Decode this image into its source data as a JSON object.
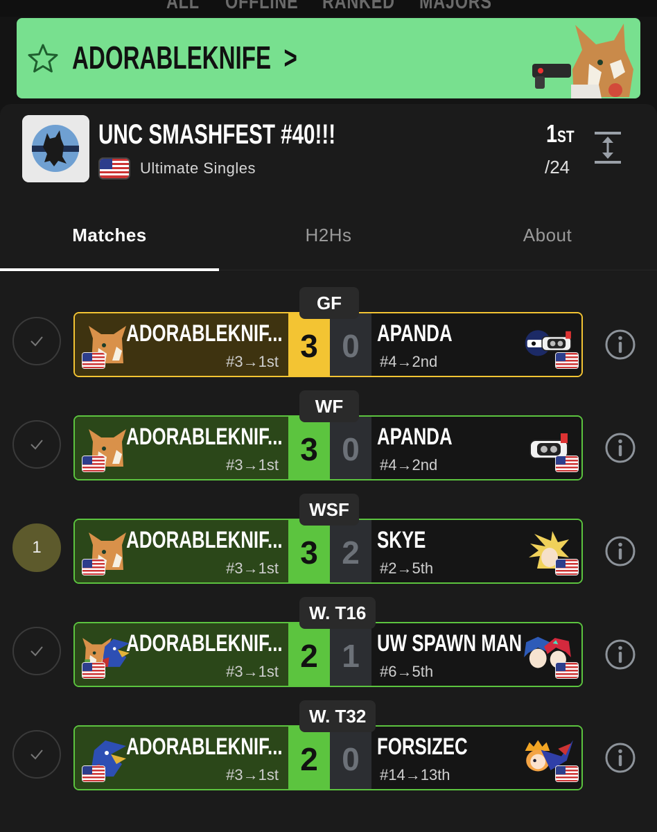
{
  "top_nav": {
    "items": [
      "ALL",
      "OFFLINE",
      "RANKED",
      "MAJORS"
    ]
  },
  "banner": {
    "player_name": "ADORABLEKNIFE",
    "chevron": ">",
    "character_icon": "fox-icon"
  },
  "tournament": {
    "title": "UNC SMASHFEST #40!!!",
    "event": "Ultimate Singles",
    "placement": "1",
    "placement_suffix": "ST",
    "entrants": "/24",
    "flag_icon": "us-flag-icon"
  },
  "tabs": [
    {
      "label": "Matches",
      "active": true
    },
    {
      "label": "H2Hs",
      "active": false
    },
    {
      "label": "About",
      "active": false
    }
  ],
  "colors": {
    "banner_green": "#78e08f",
    "win_gold": "#f3c433",
    "win_green": "#5cc43f"
  },
  "matches": [
    {
      "round": "GF",
      "status": "check",
      "status_label": "✓",
      "style": "gold",
      "p1": {
        "name": "ADORABLEKNIF...",
        "seed": "#3→1st",
        "characters": [
          "fox-icon"
        ]
      },
      "p1_score": "3",
      "p2_score": "0",
      "p2": {
        "name": "APANDA",
        "seed": "#4→2nd",
        "characters": [
          "mr-game-and-watch-icon",
          "rob-icon"
        ]
      }
    },
    {
      "round": "WF",
      "status": "check",
      "status_label": "✓",
      "style": "green",
      "p1": {
        "name": "ADORABLEKNIF...",
        "seed": "#3→1st",
        "characters": [
          "fox-icon"
        ]
      },
      "p1_score": "3",
      "p2_score": "0",
      "p2": {
        "name": "APANDA",
        "seed": "#4→2nd",
        "characters": [
          "rob-icon"
        ]
      }
    },
    {
      "round": "WSF",
      "status": "seed",
      "status_label": "1",
      "style": "green",
      "p1": {
        "name": "ADORABLEKNIF...",
        "seed": "#3→1st",
        "characters": [
          "fox-icon"
        ]
      },
      "p1_score": "3",
      "p2_score": "2",
      "p2": {
        "name": "SKYE",
        "seed": "#2→5th",
        "characters": [
          "cloud-icon"
        ]
      }
    },
    {
      "round": "W. T16",
      "status": "check",
      "status_label": "✓",
      "style": "green",
      "p1": {
        "name": "ADORABLEKNIF...",
        "seed": "#3→1st",
        "characters": [
          "fox-icon",
          "falco-icon"
        ]
      },
      "p1_score": "2",
      "p2_score": "1",
      "p2": {
        "name": "UW SPAWN MAN",
        "seed": "#6→5th",
        "characters": [
          "ike-icon",
          "pyra-icon"
        ]
      }
    },
    {
      "round": "W. T32",
      "status": "check",
      "status_label": "✓",
      "style": "green",
      "p1": {
        "name": "ADORABLEKNIF...",
        "seed": "#3→1st",
        "characters": [
          "falco-icon"
        ]
      },
      "p1_score": "2",
      "p2_score": "0",
      "p2": {
        "name": "FORSIZEC",
        "seed": "#14→13th",
        "characters": [
          "daisy-icon",
          "greninja-icon"
        ]
      }
    }
  ]
}
